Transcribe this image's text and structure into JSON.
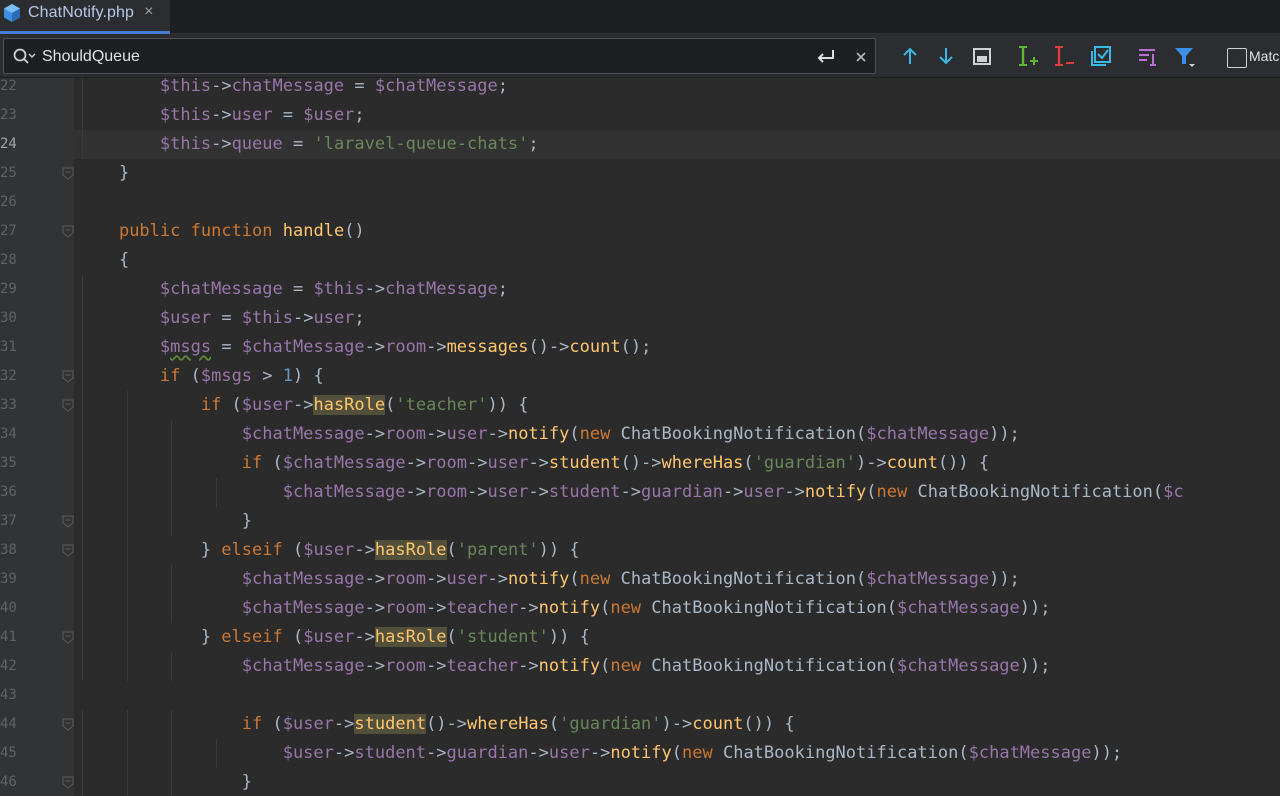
{
  "tab": {
    "title": "ChatNotify.php",
    "close": "×"
  },
  "search": {
    "value": "ShouldQueue",
    "match_label": "Matc"
  },
  "toolbar": {
    "icons": [
      "arrow-up-icon",
      "arrow-down-icon",
      "select-all-occurrences-icon",
      "add-cursor-icon",
      "remove-cursor-icon",
      "select-all-matches-icon",
      "filter-lines-icon",
      "filter-icon"
    ]
  },
  "editor": {
    "lines": [
      {
        "num": "22",
        "text": "        $this->chatMessage = $chatMessage;"
      },
      {
        "num": "23",
        "text": "        $this->user = $user;"
      },
      {
        "num": "24",
        "text": "        $this->queue = 'laravel-queue-chats';"
      },
      {
        "num": "25",
        "text": "    }"
      },
      {
        "num": "26",
        "text": ""
      },
      {
        "num": "27",
        "text": "    public function handle()"
      },
      {
        "num": "28",
        "text": "    {"
      },
      {
        "num": "29",
        "text": "        $chatMessage = $this->chatMessage;"
      },
      {
        "num": "30",
        "text": "        $user = $this->user;"
      },
      {
        "num": "31",
        "text": "        $msgs = $chatMessage->room->messages()->count();"
      },
      {
        "num": "32",
        "text": "        if ($msgs > 1) {"
      },
      {
        "num": "33",
        "text": "            if ($user->hasRole('teacher')) {"
      },
      {
        "num": "34",
        "text": "                $chatMessage->room->user->notify(new ChatBookingNotification($chatMessage));"
      },
      {
        "num": "35",
        "text": "                if ($chatMessage->room->user->student()->whereHas('guardian')->count()) {"
      },
      {
        "num": "36",
        "text": "                    $chatMessage->room->user->student->guardian->user->notify(new ChatBookingNotification($c"
      },
      {
        "num": "37",
        "text": "                }"
      },
      {
        "num": "38",
        "text": "            } elseif ($user->hasRole('parent')) {"
      },
      {
        "num": "39",
        "text": "                $chatMessage->room->user->notify(new ChatBookingNotification($chatMessage));"
      },
      {
        "num": "40",
        "text": "                $chatMessage->room->teacher->notify(new ChatBookingNotification($chatMessage));"
      },
      {
        "num": "41",
        "text": "            } elseif ($user->hasRole('student')) {"
      },
      {
        "num": "42",
        "text": "                $chatMessage->room->teacher->notify(new ChatBookingNotification($chatMessage));"
      },
      {
        "num": "43",
        "text": ""
      },
      {
        "num": "44",
        "text": "                if ($user->student()->whereHas('guardian')->count()) {"
      },
      {
        "num": "45",
        "text": "                    $user->student->guardian->user->notify(new ChatBookingNotification($chatMessage));"
      },
      {
        "num": "46",
        "text": "                }"
      }
    ],
    "current_line": "24"
  },
  "colors": {
    "keyword": "#cc7832",
    "variable": "#9876aa",
    "function": "#ffc66d",
    "string": "#6a8759",
    "number": "#6897bb",
    "default": "#a9b7c6",
    "highlight": "#52503a"
  }
}
